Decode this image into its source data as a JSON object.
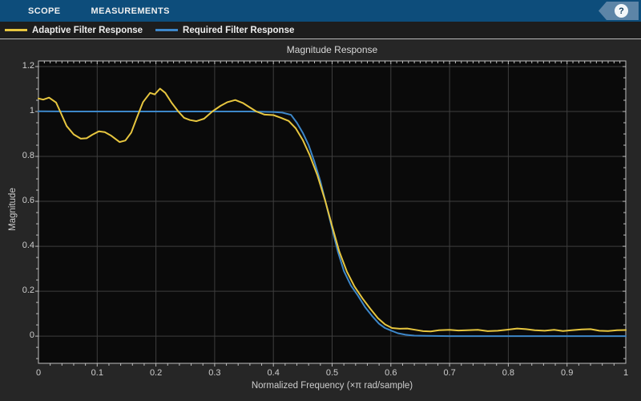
{
  "toolbar": {
    "tabs": [
      {
        "label": "SCOPE"
      },
      {
        "label": "MEASUREMENTS"
      }
    ],
    "help_label": "?"
  },
  "legend": {
    "items": [
      {
        "label": "Adaptive Filter Response",
        "color": "#e7c63f"
      },
      {
        "label": "Required Filter Response",
        "color": "#3d87c9"
      }
    ]
  },
  "chart_data": {
    "type": "line",
    "title": "Magnitude Response",
    "xlabel": "Normalized Frequency (×π rad/sample)",
    "ylabel": "Magnitude",
    "xlim": [
      0,
      1
    ],
    "ylim": [
      -0.121,
      1.225
    ],
    "grid": true,
    "legend_position": "top-outside",
    "xticks": {
      "values": [
        0,
        0.1,
        0.2,
        0.3,
        0.4,
        0.5,
        0.6,
        0.7,
        0.8,
        0.9,
        1
      ],
      "labels": [
        "0",
        "0.1",
        "0.2",
        "0.3",
        "0.4",
        "0.5",
        "0.6",
        "0.7",
        "0.8",
        "0.9",
        "1"
      ]
    },
    "yticks": {
      "values": [
        0,
        0.2,
        0.4,
        0.6,
        0.8,
        1,
        1.2
      ],
      "labels": [
        "0",
        "0.2",
        "0.4",
        "0.6",
        "0.8",
        "1",
        "1.2"
      ]
    },
    "colors": {
      "plot_bg": "#0a0a0a",
      "figure_bg": "#262626",
      "grid": "#3e3e3e",
      "frame": "#bfbfbf",
      "tick_text": "#cdcdcd",
      "toolbar": "#0d4d7b"
    },
    "series": [
      {
        "name": "Adaptive Filter Response",
        "color": "#e7c63f",
        "points": [
          [
            0,
            1.058
          ],
          [
            0.008,
            1.053
          ],
          [
            0.018,
            1.062
          ],
          [
            0.03,
            1.04
          ],
          [
            0.037,
            1.0
          ],
          [
            0.048,
            0.935
          ],
          [
            0.06,
            0.898
          ],
          [
            0.072,
            0.879
          ],
          [
            0.082,
            0.881
          ],
          [
            0.092,
            0.897
          ],
          [
            0.103,
            0.912
          ],
          [
            0.113,
            0.908
          ],
          [
            0.124,
            0.892
          ],
          [
            0.138,
            0.864
          ],
          [
            0.148,
            0.871
          ],
          [
            0.158,
            0.906
          ],
          [
            0.168,
            0.975
          ],
          [
            0.178,
            1.042
          ],
          [
            0.19,
            1.083
          ],
          [
            0.198,
            1.076
          ],
          [
            0.207,
            1.102
          ],
          [
            0.216,
            1.083
          ],
          [
            0.227,
            1.038
          ],
          [
            0.238,
            1.0
          ],
          [
            0.248,
            0.972
          ],
          [
            0.258,
            0.962
          ],
          [
            0.269,
            0.957
          ],
          [
            0.282,
            0.968
          ],
          [
            0.296,
            1.0
          ],
          [
            0.31,
            1.025
          ],
          [
            0.322,
            1.042
          ],
          [
            0.335,
            1.051
          ],
          [
            0.348,
            1.038
          ],
          [
            0.36,
            1.018
          ],
          [
            0.371,
            1.0
          ],
          [
            0.385,
            0.986
          ],
          [
            0.4,
            0.984
          ],
          [
            0.413,
            0.972
          ],
          [
            0.426,
            0.958
          ],
          [
            0.438,
            0.925
          ],
          [
            0.45,
            0.873
          ],
          [
            0.462,
            0.805
          ],
          [
            0.475,
            0.715
          ],
          [
            0.488,
            0.605
          ],
          [
            0.5,
            0.49
          ],
          [
            0.512,
            0.378
          ],
          [
            0.525,
            0.288
          ],
          [
            0.538,
            0.221
          ],
          [
            0.552,
            0.167
          ],
          [
            0.565,
            0.122
          ],
          [
            0.578,
            0.08
          ],
          [
            0.59,
            0.052
          ],
          [
            0.602,
            0.036
          ],
          [
            0.615,
            0.033
          ],
          [
            0.628,
            0.034
          ],
          [
            0.642,
            0.028
          ],
          [
            0.655,
            0.022
          ],
          [
            0.668,
            0.021
          ],
          [
            0.682,
            0.026
          ],
          [
            0.7,
            0.028
          ],
          [
            0.715,
            0.025
          ],
          [
            0.73,
            0.026
          ],
          [
            0.748,
            0.028
          ],
          [
            0.765,
            0.022
          ],
          [
            0.782,
            0.024
          ],
          [
            0.8,
            0.029
          ],
          [
            0.815,
            0.034
          ],
          [
            0.83,
            0.031
          ],
          [
            0.845,
            0.026
          ],
          [
            0.862,
            0.024
          ],
          [
            0.878,
            0.028
          ],
          [
            0.893,
            0.023
          ],
          [
            0.908,
            0.026
          ],
          [
            0.925,
            0.03
          ],
          [
            0.94,
            0.031
          ],
          [
            0.955,
            0.024
          ],
          [
            0.97,
            0.023
          ],
          [
            0.985,
            0.026
          ],
          [
            1,
            0.027
          ]
        ]
      },
      {
        "name": "Required Filter Response",
        "color": "#3d87c9",
        "points": [
          [
            0,
            1.001
          ],
          [
            0.05,
            1.0
          ],
          [
            0.1,
            1.0
          ],
          [
            0.15,
            1.0
          ],
          [
            0.2,
            1.0
          ],
          [
            0.25,
            1.0
          ],
          [
            0.3,
            1.0
          ],
          [
            0.36,
            1.0
          ],
          [
            0.4,
            0.998
          ],
          [
            0.415,
            0.995
          ],
          [
            0.43,
            0.985
          ],
          [
            0.44,
            0.95
          ],
          [
            0.45,
            0.905
          ],
          [
            0.46,
            0.85
          ],
          [
            0.47,
            0.775
          ],
          [
            0.48,
            0.69
          ],
          [
            0.49,
            0.585
          ],
          [
            0.5,
            0.478
          ],
          [
            0.51,
            0.375
          ],
          [
            0.52,
            0.29
          ],
          [
            0.532,
            0.225
          ],
          [
            0.544,
            0.18
          ],
          [
            0.556,
            0.13
          ],
          [
            0.568,
            0.09
          ],
          [
            0.58,
            0.055
          ],
          [
            0.59,
            0.036
          ],
          [
            0.6,
            0.025
          ],
          [
            0.612,
            0.013
          ],
          [
            0.625,
            0.006
          ],
          [
            0.64,
            0.002
          ],
          [
            0.66,
            0.001
          ],
          [
            0.7,
            0
          ],
          [
            0.75,
            0
          ],
          [
            0.8,
            0
          ],
          [
            0.85,
            0
          ],
          [
            0.9,
            0
          ],
          [
            0.95,
            0
          ],
          [
            1,
            0
          ]
        ]
      }
    ]
  }
}
